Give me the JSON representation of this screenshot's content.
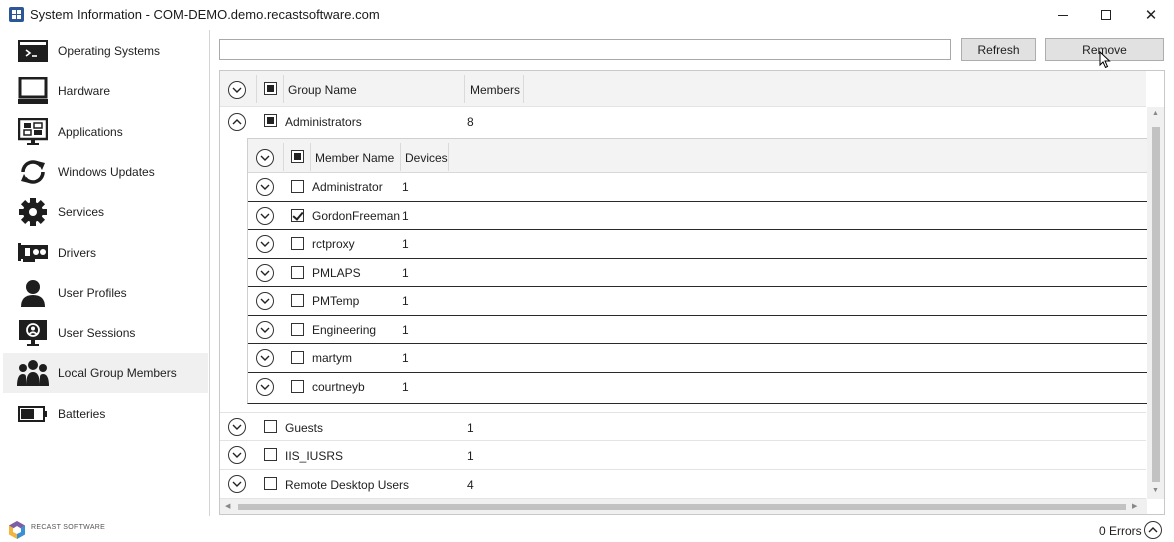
{
  "window": {
    "title": "System Information - COM-DEMO.demo.recastsoftware.com",
    "close_glyph": "✕"
  },
  "sidebar": {
    "items": [
      {
        "label": "Operating Systems",
        "icon": "terminal-icon"
      },
      {
        "label": "Hardware",
        "icon": "laptop-icon"
      },
      {
        "label": "Applications",
        "icon": "applications-icon"
      },
      {
        "label": "Windows Updates",
        "icon": "refresh-arrows-icon"
      },
      {
        "label": "Services",
        "icon": "gear-icon"
      },
      {
        "label": "Drivers",
        "icon": "driver-card-icon"
      },
      {
        "label": "User Profiles",
        "icon": "user-icon"
      },
      {
        "label": "User Sessions",
        "icon": "user-session-icon"
      },
      {
        "label": "Local Group Members",
        "icon": "group-icon",
        "active": true
      },
      {
        "label": "Batteries",
        "icon": "battery-icon"
      }
    ]
  },
  "toolbar": {
    "search_value": "",
    "refresh_label": "Refresh",
    "remove_label": "Remove"
  },
  "grid": {
    "columns": [
      "Group Name",
      "Members"
    ],
    "groups": [
      {
        "name": "Administrators",
        "members": "8",
        "expanded": true,
        "checkbox": "partial",
        "member_columns": [
          "Member Name",
          "Devices"
        ],
        "member_rows": [
          {
            "name": "Administrator",
            "devices": "1",
            "checked": false
          },
          {
            "name": "GordonFreeman",
            "devices": "1",
            "checked": true
          },
          {
            "name": "rctproxy",
            "devices": "1",
            "checked": false
          },
          {
            "name": "PMLAPS",
            "devices": "1",
            "checked": false
          },
          {
            "name": "PMTemp",
            "devices": "1",
            "checked": false
          },
          {
            "name": "Engineering",
            "devices": "1",
            "checked": false
          },
          {
            "name": "martym",
            "devices": "1",
            "checked": false
          },
          {
            "name": "courtneyb",
            "devices": "1",
            "checked": false
          }
        ]
      },
      {
        "name": "Guests",
        "members": "1",
        "expanded": false,
        "checkbox": "unchecked"
      },
      {
        "name": "IIS_IUSRS",
        "members": "1",
        "expanded": false,
        "checkbox": "unchecked"
      },
      {
        "name": "Remote Desktop Users",
        "members": "4",
        "expanded": false,
        "checkbox": "unchecked"
      }
    ]
  },
  "footer": {
    "logo_text": "RECAST SOFTWARE",
    "errors_label": "0 Errors"
  },
  "colors": {
    "accent": "#2b5797",
    "button_bg": "#e1e1e1",
    "header_bg": "#f3f3f3",
    "active_nav_bg": "#f0f0f0"
  }
}
